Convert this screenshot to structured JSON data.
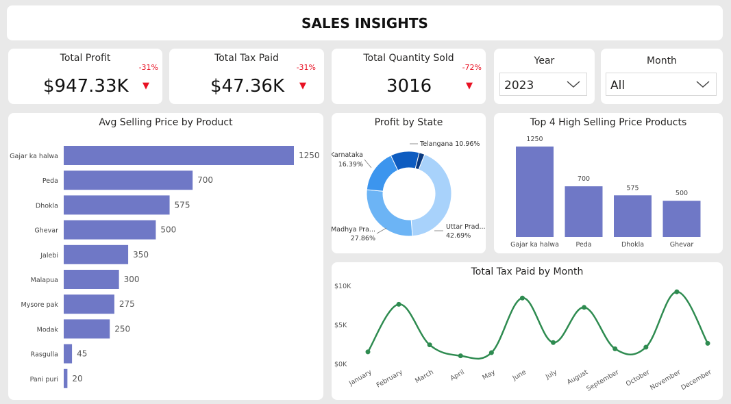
{
  "title": "SALES INSIGHTS",
  "kpis": [
    {
      "label": "Total Profit",
      "value": "$947.33K",
      "delta": "-31%",
      "indicator": "down-arrow-icon"
    },
    {
      "label": "Total Tax Paid",
      "value": "$47.36K",
      "delta": "-31%",
      "indicator": "down-arrow-icon"
    },
    {
      "label": "Total Quantity Sold",
      "value": "3016",
      "delta": "-72%",
      "indicator": "down-arrow-icon"
    }
  ],
  "filters": {
    "year": {
      "label": "Year",
      "value": "2023",
      "icon": "chevron-down-icon"
    },
    "month": {
      "label": "Month",
      "value": "All",
      "icon": "chevron-down-icon"
    }
  },
  "colors": {
    "bar": "#6f78c6",
    "line": "#2e8b50",
    "negative": "#e81123",
    "donut": [
      "#a8d2fb",
      "#6cb4f5",
      "#3c95ee",
      "#0e5cc0",
      "#0a3a80"
    ]
  },
  "chart_data": [
    {
      "type": "bar",
      "orientation": "horizontal",
      "title": "Avg Selling Price by Product",
      "categories": [
        "Gajar ka halwa",
        "Peda",
        "Dhokla",
        "Ghevar",
        "Jalebi",
        "Malapua",
        "Mysore pak",
        "Modak",
        "Rasgulla",
        "Pani puri"
      ],
      "values": [
        1250,
        700,
        575,
        500,
        350,
        300,
        275,
        250,
        45,
        20
      ],
      "data_labels": [
        "1250",
        "700",
        "575",
        "500",
        "350",
        "300",
        "275",
        "250",
        "45",
        "20"
      ]
    },
    {
      "type": "pie",
      "variant": "donut",
      "title": "Profit by State",
      "slices": [
        {
          "label": "Uttar Prad...",
          "value": 42.69,
          "pct_label": "42.69%"
        },
        {
          "label": "Madhya Pra...",
          "value": 27.86,
          "pct_label": "27.86%"
        },
        {
          "label": "Karnataka",
          "value": 16.39,
          "pct_label": "16.39%"
        },
        {
          "label": "Telangana",
          "value": 10.96,
          "pct_label": "10.96%"
        },
        {
          "label": "",
          "value": 2.1,
          "pct_label": ""
        }
      ]
    },
    {
      "type": "bar",
      "title": "Top 4 High Selling Price Products",
      "categories": [
        "Gajar ka halwa",
        "Peda",
        "Dhokla",
        "Ghevar"
      ],
      "values": [
        1250,
        700,
        575,
        500
      ],
      "data_labels": [
        "1250",
        "700",
        "575",
        "500"
      ]
    },
    {
      "type": "line",
      "title": "Total Tax Paid by Month",
      "categories": [
        "January",
        "February",
        "March",
        "April",
        "May",
        "June",
        "July",
        "August",
        "September",
        "October",
        "November",
        "December"
      ],
      "values": [
        1500,
        7600,
        2400,
        1000,
        1400,
        8400,
        2700,
        7200,
        1900,
        2100,
        9200,
        2600
      ],
      "yticks": [
        0,
        5000,
        10000
      ],
      "ytick_labels": [
        "$0K",
        "$5K",
        "$10K"
      ],
      "ylim": [
        0,
        10000
      ],
      "smooth": true
    }
  ]
}
